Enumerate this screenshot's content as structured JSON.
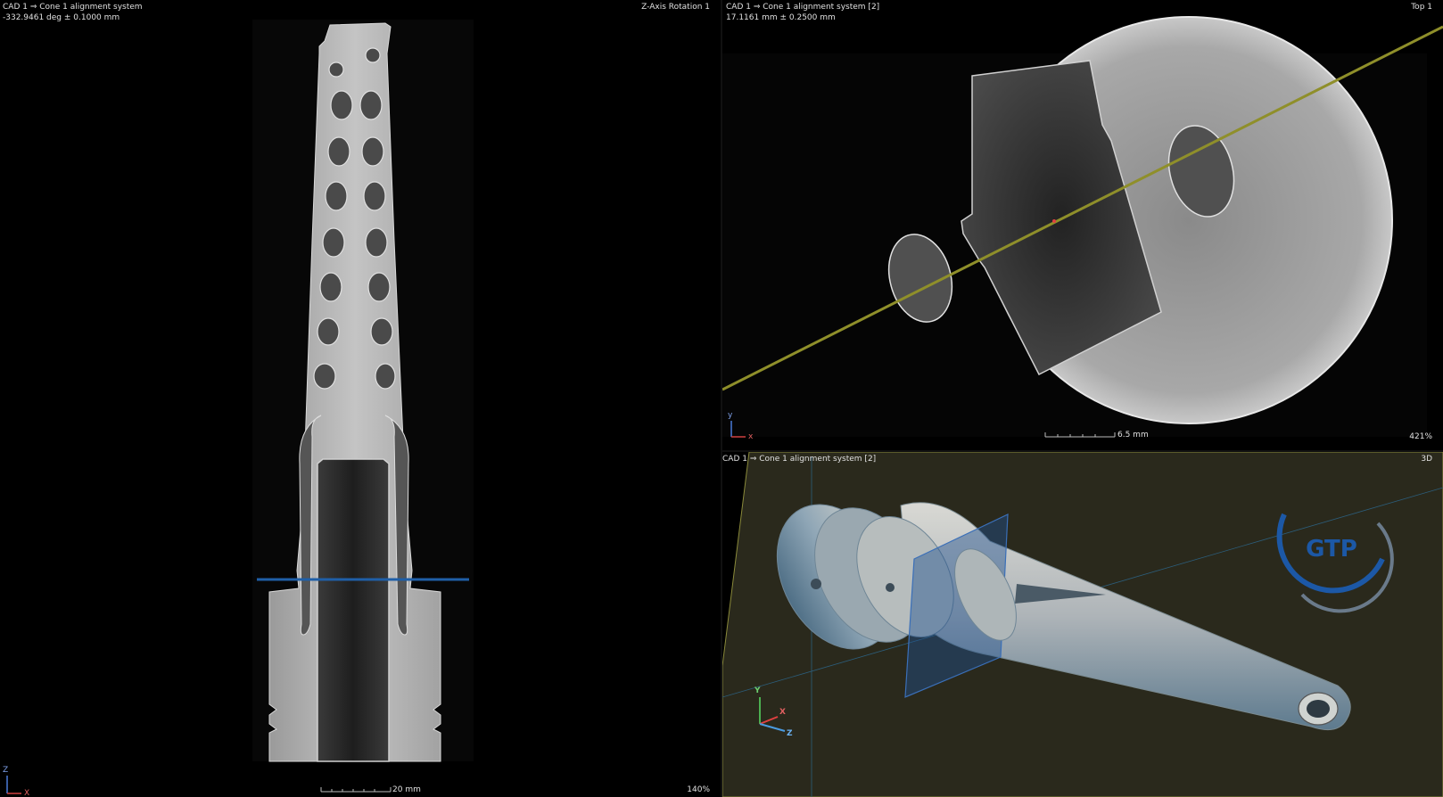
{
  "left_view": {
    "title": "CAD 1 ⇒ Cone 1 alignment system",
    "measurement": "-332.9461 deg ± 0.1000 mm",
    "view_name": "Z-Axis Rotation 1",
    "scale_label": "20 mm",
    "zoom": "140%",
    "axes": {
      "z": "Z",
      "x": "X"
    }
  },
  "top_right_view": {
    "title": "CAD 1 ⇒ Cone 1 alignment system [2]",
    "measurement": "17.1161 mm ± 0.2500 mm",
    "view_name": "Top 1",
    "scale_label": "6.5 mm",
    "zoom": "421%",
    "axes": {
      "y": "y",
      "x": "x"
    }
  },
  "bottom_right_view": {
    "title": "CAD 1 ⇒ Cone 1 alignment system [2]",
    "view_name": "3D",
    "axes": {
      "y": "Y",
      "x": "X",
      "z": "Z"
    },
    "logo_text": "GTP"
  },
  "colors": {
    "section_line_left": "#1f5fa8",
    "section_line_top": "#8f8f2a",
    "ground_plane": "#2a291c",
    "logo_blue": "#1c58a6"
  }
}
